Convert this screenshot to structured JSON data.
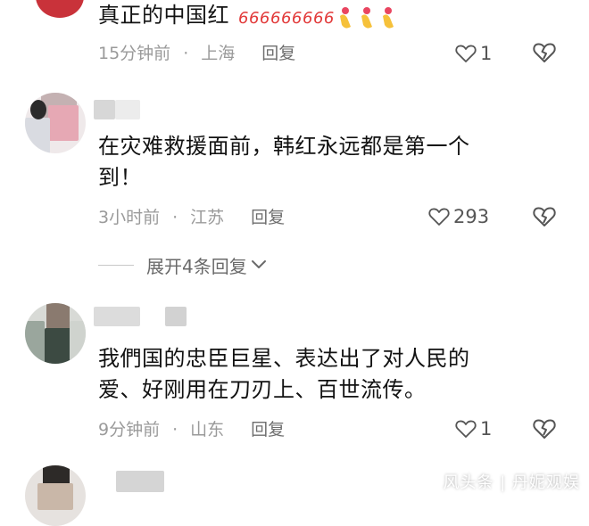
{
  "comments": [
    {
      "text_lines": [
        "真正的中国红"
      ],
      "emojis": "👌👌👌🫰🫰🫰",
      "time": "15分钟前",
      "location": "上海",
      "reply_label": "回复",
      "likes": "1"
    },
    {
      "text_lines": [
        "在灾难救援面前，韩红永远都是第一个",
        "到！"
      ],
      "time": "3小时前",
      "location": "江苏",
      "reply_label": "回复",
      "likes": "293",
      "expand_label": "展开4条回复"
    },
    {
      "text_lines": [
        "我們国的忠臣巨星、表达出了对人民的",
        "爱、好刚用在刀刃上、百世流传。"
      ],
      "time": "9分钟前",
      "location": "山东",
      "reply_label": "回复",
      "likes": "1"
    }
  ],
  "separator_dot": "·",
  "watermark": "风头条 | 丹妮观娱",
  "colors": {
    "meta_gray": "#9a9a9a",
    "text": "#121212",
    "accent_red": "#e23a3a"
  }
}
